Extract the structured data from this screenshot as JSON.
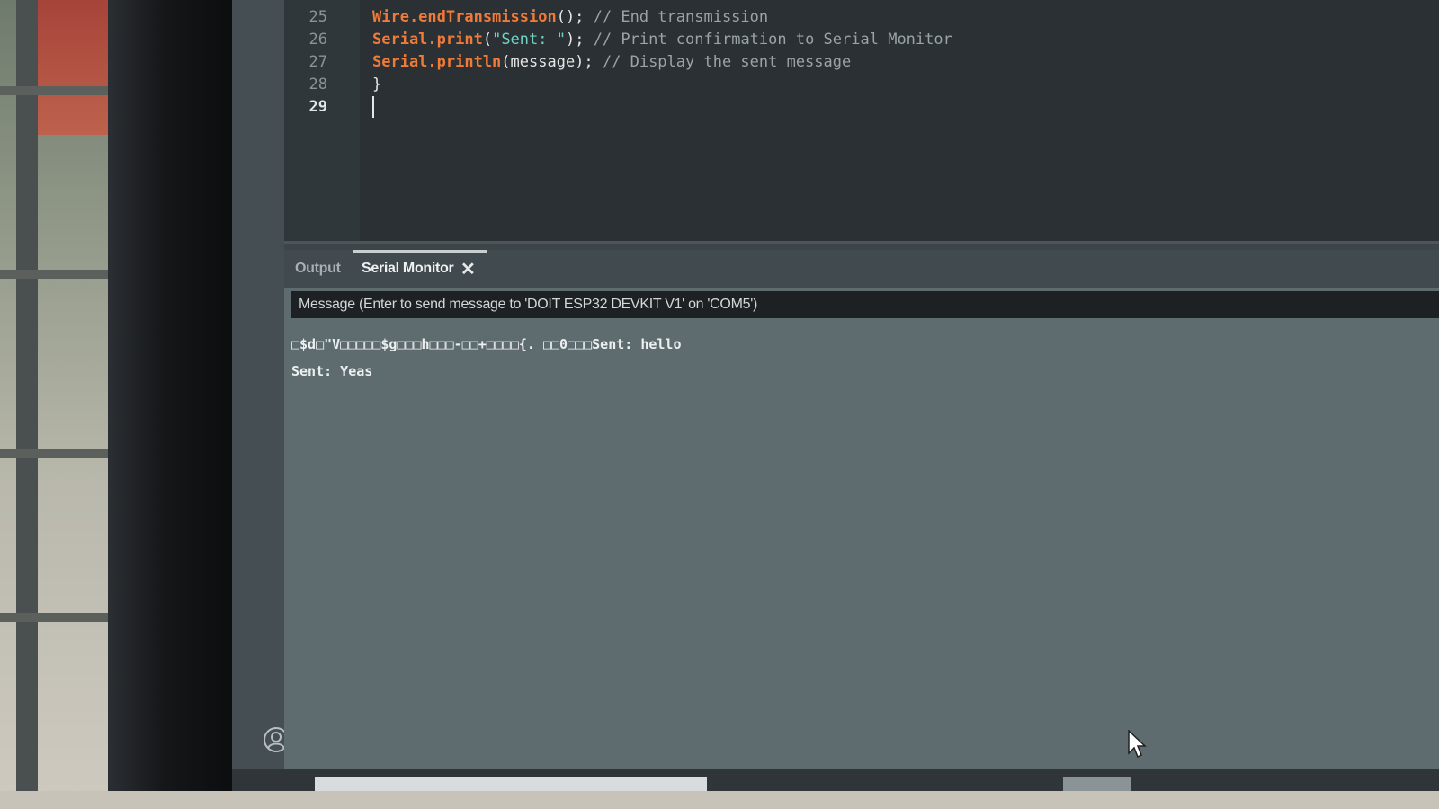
{
  "editor": {
    "lines": [
      {
        "number": "25",
        "tokens": [
          {
            "cls": "kw-obj",
            "text": "Wire.endTransmission"
          },
          {
            "cls": "kw-plain",
            "text": "();"
          },
          {
            "cls": "kw-cmt",
            "text": " // End transmission"
          }
        ]
      },
      {
        "number": "26",
        "tokens": [
          {
            "cls": "kw-obj",
            "text": "Serial.print"
          },
          {
            "cls": "kw-plain",
            "text": "("
          },
          {
            "cls": "kw-str",
            "text": "\"Sent: \""
          },
          {
            "cls": "kw-plain",
            "text": ");"
          },
          {
            "cls": "kw-cmt",
            "text": " // Print confirmation to Serial Monitor"
          }
        ]
      },
      {
        "number": "27",
        "tokens": [
          {
            "cls": "kw-obj",
            "text": "Serial.println"
          },
          {
            "cls": "kw-plain",
            "text": "(message);"
          },
          {
            "cls": "kw-cmt",
            "text": " // Display the sent message"
          }
        ]
      },
      {
        "number": "28",
        "tokens": [
          {
            "cls": "kw-plain",
            "text": "}"
          }
        ]
      },
      {
        "number": "29",
        "tokens": [],
        "active": true
      }
    ]
  },
  "panel": {
    "tabs": {
      "output": "Output",
      "serial_monitor": "Serial Monitor"
    },
    "close_glyph": "✕",
    "message_placeholder": "Message (Enter to send message to 'DOIT ESP32 DEVKIT V1' on 'COM5')",
    "serial_lines": [
      "□$d□\"V□□□□□$g□□□h□□□-□□+□□□□{. □□0□□□Sent: hello",
      "Sent: Yeas"
    ]
  },
  "icons": {
    "account": "account-icon",
    "close": "close-icon",
    "pointer": "mouse-pointer-icon"
  }
}
